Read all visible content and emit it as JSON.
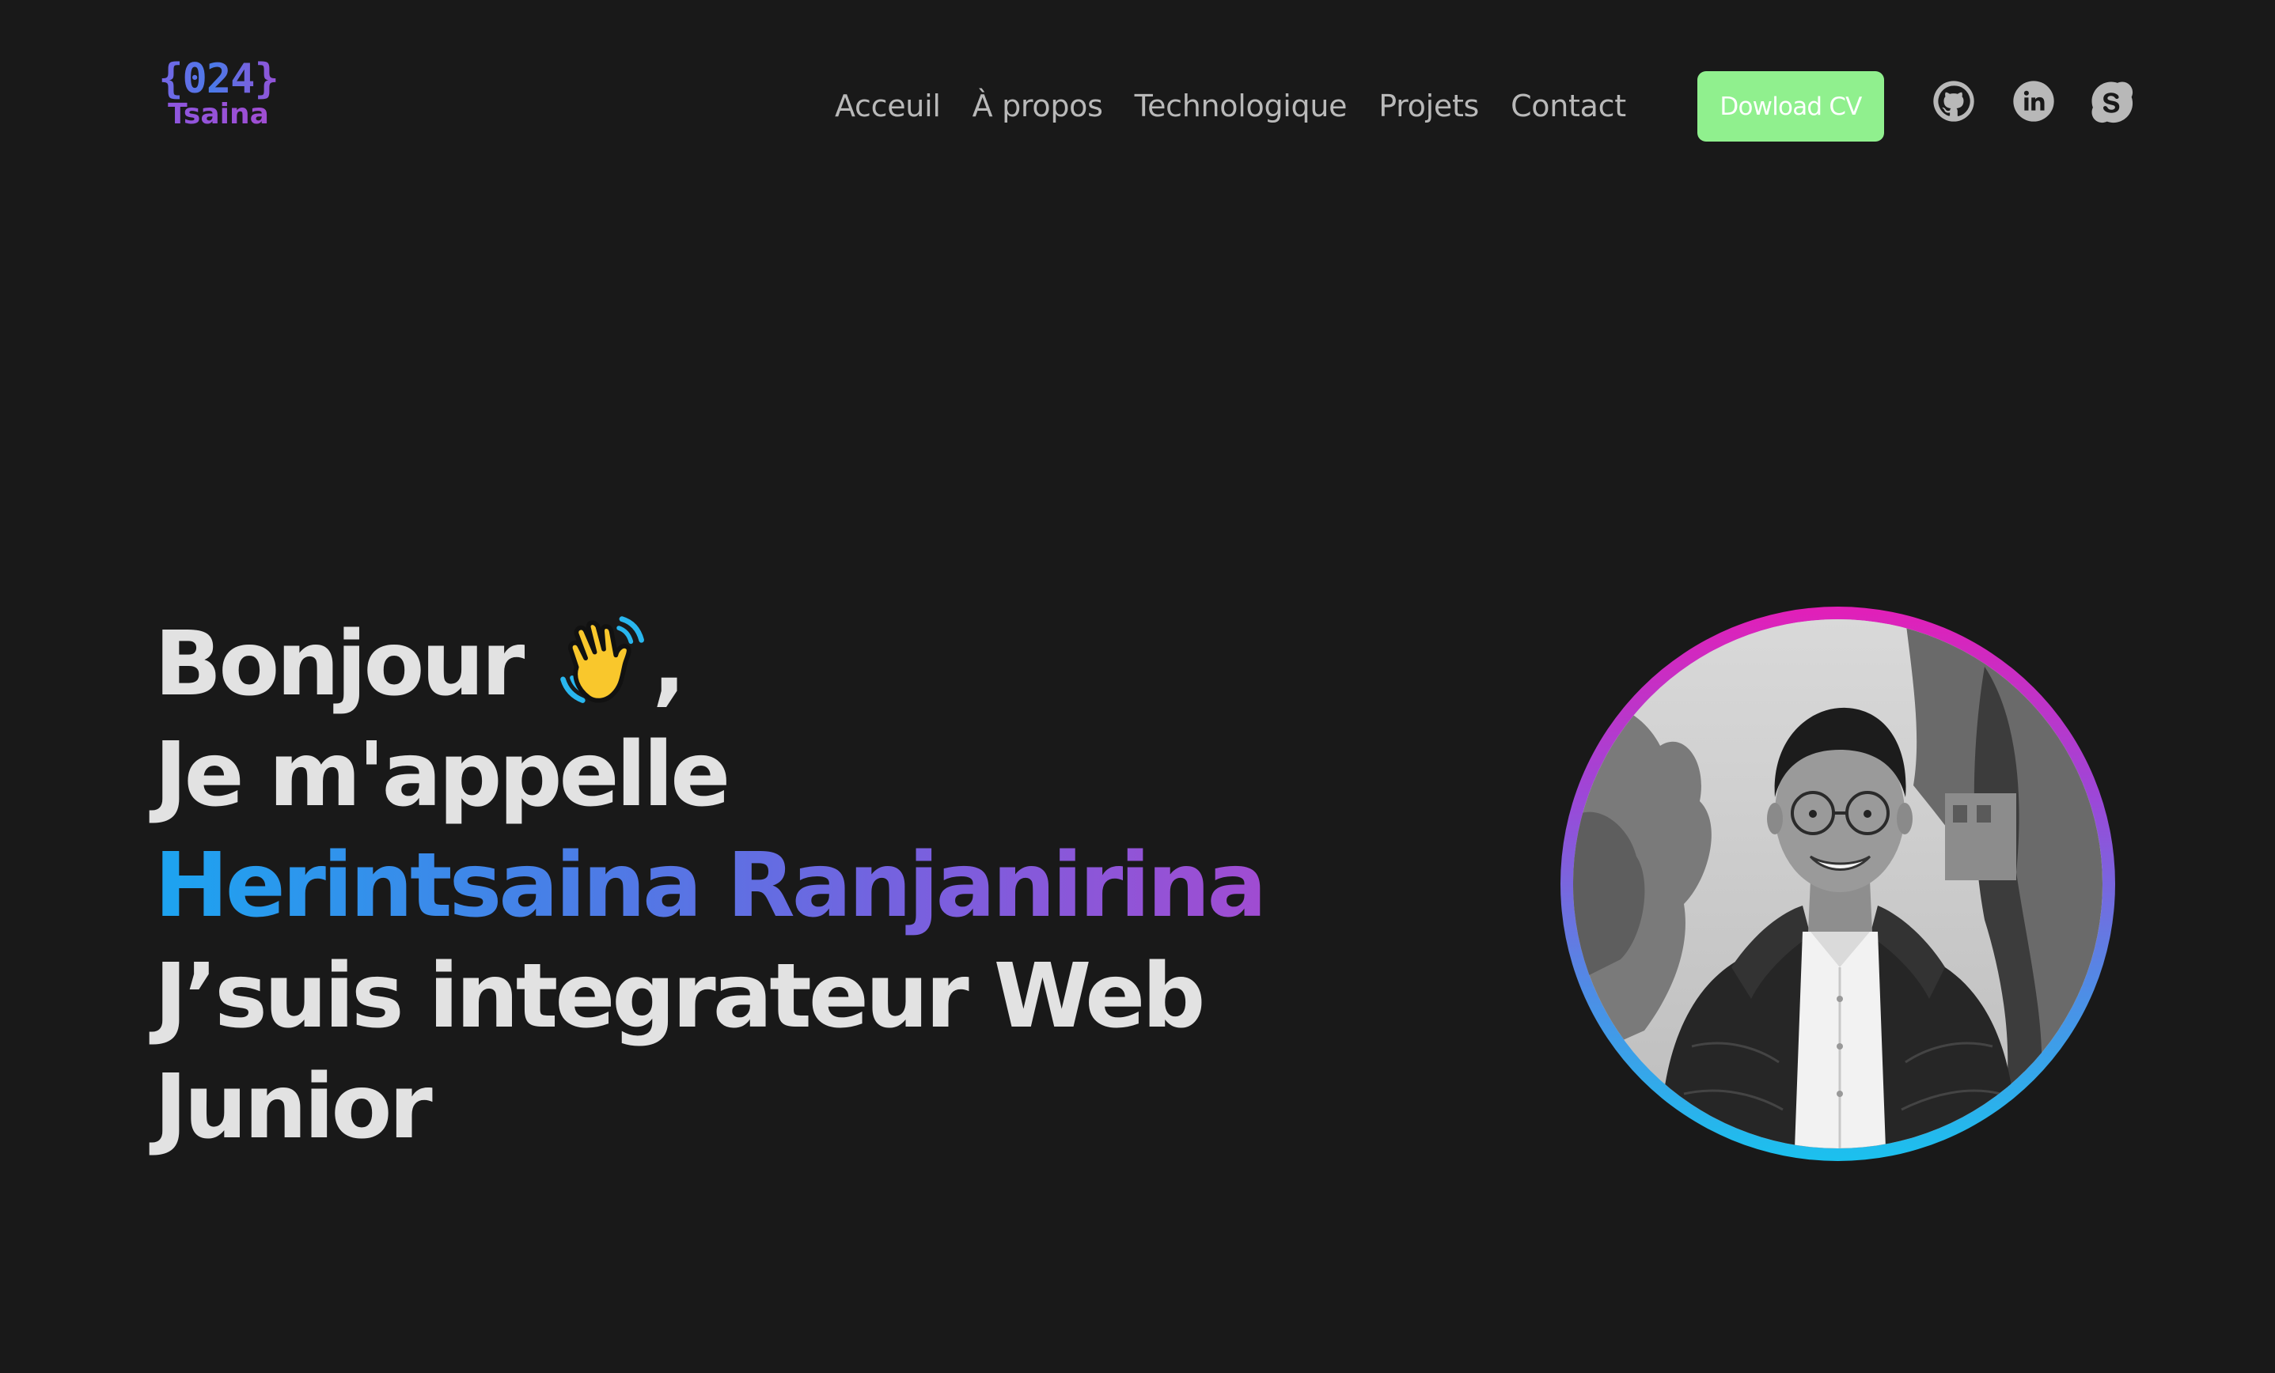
{
  "header": {
    "logo": {
      "code": "{024}",
      "name": "Tsaina"
    },
    "nav": [
      {
        "label": "Acceuil"
      },
      {
        "label": "À propos"
      },
      {
        "label": "Technologique"
      },
      {
        "label": "Projets"
      },
      {
        "label": "Contact"
      }
    ],
    "cv_button": "Dowload CV",
    "social": [
      {
        "icon": "github-icon"
      },
      {
        "icon": "linkedin-icon"
      },
      {
        "icon": "skype-icon"
      }
    ]
  },
  "hero": {
    "greeting": "Bonjour",
    "greeting_emoji": "waving-hand-icon",
    "greeting_suffix": ",",
    "intro": "Je m'appelle",
    "name": "Herintsaina Ranjanirina",
    "role_line1": "J’suis integrateur Web",
    "role_line2": "Junior"
  },
  "profile": {
    "image": "profile-photo"
  },
  "colors": {
    "background": "#191919",
    "button": "#90f08e",
    "gradient_start": "#1ca4f0",
    "gradient_end": "#a04cd2",
    "ring_top": "#e21fb8",
    "ring_bottom": "#1bc1ee"
  }
}
